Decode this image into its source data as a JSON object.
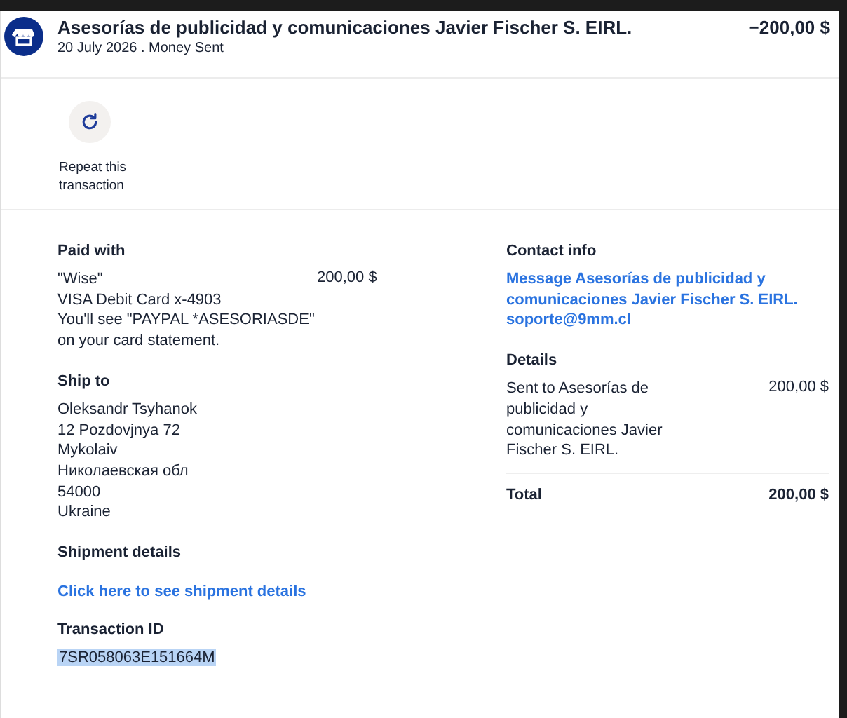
{
  "header": {
    "merchant": "Asesorías de publicidad y comunicaciones Javier Fischer S. EIRL.",
    "subtitle": "20 July 2026 . Money Sent",
    "amount": "−200,00 $"
  },
  "actions": [
    {
      "label": "Repeat this transaction"
    }
  ],
  "paid_with": {
    "heading": "Paid with",
    "lines": [
      "\"Wise\"",
      "VISA Debit Card x-4903",
      "You'll see \"PAYPAL *ASESORIASDE\" on your card statement."
    ],
    "amount": "200,00 $"
  },
  "ship_to": {
    "heading": "Ship to",
    "lines": [
      "Oleksandr Tsyhanok",
      "12 Pozdovjnya 72",
      "Mykolaiv",
      "Николаевская обл",
      "54000",
      "Ukraine"
    ]
  },
  "shipment_details": {
    "heading": "Shipment details",
    "link": "Click here to see shipment details"
  },
  "transaction_id": {
    "heading": "Transaction ID",
    "value": "7SR058063E151664M",
    "highlighted": true
  },
  "contact_info": {
    "heading": "Contact info",
    "message_link": "Message Asesorías de publicidad y comunicaciones Javier Fischer S. EIRL.",
    "email": "soporte@9mm.cl"
  },
  "details": {
    "heading": "Details",
    "rows": [
      {
        "label": "Sent to Asesorías de publicidad y comunicaciones Javier Fischer S. EIRL.",
        "amount": "200,00 $"
      }
    ],
    "total_label": "Total",
    "total_amount": "200,00 $"
  }
}
